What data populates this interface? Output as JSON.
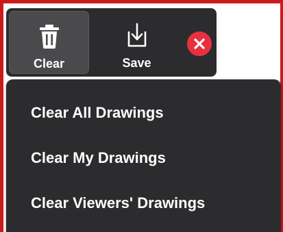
{
  "toolbar": {
    "clear_label": "Clear",
    "save_label": "Save",
    "clear_icon": "trash-icon",
    "save_icon": "save-download-icon",
    "close_icon": "close-icon"
  },
  "menu": {
    "items": [
      {
        "label": "Clear All Drawings"
      },
      {
        "label": "Clear My Drawings"
      },
      {
        "label": "Clear Viewers' Drawings"
      }
    ]
  },
  "colors": {
    "panel_background": "#2c2c2e",
    "active_button": "#4a4a4c",
    "close_red": "#e8313f",
    "share_border_red": "#cc1a1a",
    "text": "#ffffff"
  }
}
